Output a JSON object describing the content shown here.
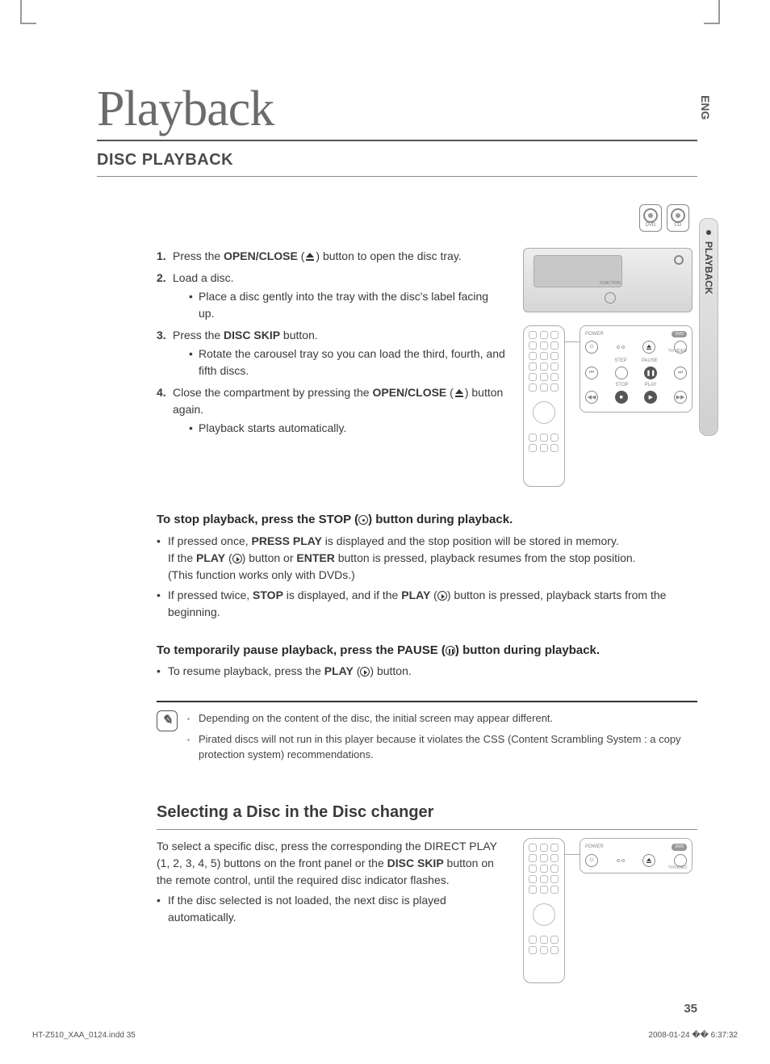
{
  "lang_tab": "ENG",
  "side_tab": "PLAYBACK",
  "title_main": "Playback",
  "section_heading": "DISC playback",
  "disc_icons": {
    "dvd": "DVD",
    "cd": "CD"
  },
  "steps": {
    "s1_pre": "Press the ",
    "s1_bold": "OPEN/CLOSE",
    "s1_post": " button to open the disc tray.",
    "s2": "Load a disc.",
    "s2_sub": "Place a disc gently into the tray with the disc's label facing up.",
    "s3_pre": "Press the ",
    "s3_bold": "DISC SKIP",
    "s3_post": " button.",
    "s3_sub": "Rotate the carousel tray so you can load the third, fourth, and fifth discs.",
    "s4_pre": "Close the compartment by pressing the ",
    "s4_bold": "OPEN/CLOSE",
    "s4_post": " button again.",
    "s4_sub": "Playback starts automatically."
  },
  "device": {
    "function_label": "FUNCTION"
  },
  "remote_labels": {
    "power": "POWER",
    "tvvideo": "TV/VIDEO",
    "dvd": "DVD",
    "step": "STEP",
    "pause": "PAUSE",
    "stop": "STOP",
    "play": "PLAY"
  },
  "stop_section": {
    "heading_pre": "To stop playback, press the STOP (",
    "heading_post": ") button during playback.",
    "b1_pre": "If pressed once, ",
    "b1_bold": "PRESS PLAY",
    "b1_mid": " is displayed and the stop position will be stored in memory.",
    "b1_line2_pre": "If the ",
    "b1_line2_bold1": "PLAY",
    "b1_line2_mid": " button or ",
    "b1_line2_bold2": "ENTER",
    "b1_line2_post": " button is pressed, playback resumes from the stop position.",
    "b1_line3": "(This function works only with DVDs.)",
    "b2_pre": "If pressed twice, ",
    "b2_bold1": "STOP",
    "b2_mid": " is displayed, and if the ",
    "b2_bold2": "PLAY",
    "b2_post": " button is pressed, playback starts from the beginning."
  },
  "pause_section": {
    "heading_pre": "To temporarily pause playback, press the ",
    "heading_pause": "PAUSE (",
    "heading_post": ") button during playback.",
    "b1_pre": "To resume playback, press the ",
    "b1_bold": "PLAY",
    "b1_post": " button."
  },
  "notes": {
    "n1": "Depending on the content of the disc, the initial screen may appear different.",
    "n2": "Pirated discs will not run in this player because it violates the CSS (Content Scrambling System : a copy protection system) recommendations."
  },
  "selecting": {
    "heading": "Selecting a Disc in the Disc changer",
    "text_pre": "To select a specific disc, press the corresponding the DIRECT PLAY (1, 2, 3, 4, 5) buttons on the front panel or the ",
    "text_bold": "DISC SKIP",
    "text_post": " button on the remote control, until the required disc indicator flashes.",
    "bullet": "If the disc selected is not loaded, the next disc is played automatically."
  },
  "page_number": "35",
  "footer_left": "HT-Z510_XAA_0124.indd   35",
  "footer_right": "2008-01-24   �� 6:37:32"
}
